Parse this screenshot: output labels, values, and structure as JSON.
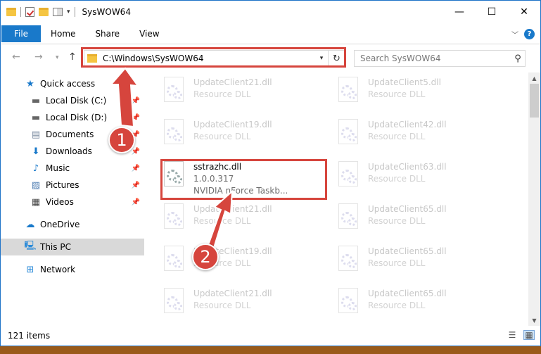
{
  "window": {
    "title": "SysWOW64",
    "controls": {
      "minimize": "—",
      "maximize": "☐",
      "close": "✕"
    }
  },
  "ribbon": {
    "tabs": [
      "File",
      "Home",
      "Share",
      "View"
    ],
    "help": "?"
  },
  "address": {
    "path": "C:\\Windows\\SysWOW64"
  },
  "search": {
    "placeholder": "Search SysWOW64"
  },
  "sidebar": {
    "items": [
      {
        "label": "Quick access",
        "icon": "star-icon",
        "pinned": false
      },
      {
        "label": "Local Disk (C:)",
        "icon": "drive-icon",
        "pinned": true
      },
      {
        "label": "Local Disk (D:)",
        "icon": "drive-icon",
        "pinned": true
      },
      {
        "label": "Documents",
        "icon": "documents-icon",
        "pinned": true
      },
      {
        "label": "Downloads",
        "icon": "download-icon",
        "pinned": true
      },
      {
        "label": "Music",
        "icon": "music-icon",
        "pinned": true
      },
      {
        "label": "Pictures",
        "icon": "pictures-icon",
        "pinned": true
      },
      {
        "label": "Videos",
        "icon": "videos-icon",
        "pinned": true
      },
      {
        "label": "OneDrive",
        "icon": "cloud-icon",
        "pinned": false
      },
      {
        "label": "This PC",
        "icon": "pc-icon",
        "pinned": false,
        "selected": true
      },
      {
        "label": "Network",
        "icon": "network-icon",
        "pinned": false
      }
    ]
  },
  "files": {
    "left": [
      {
        "name": "UpdateClient21.dll",
        "desc": "Resource DLL",
        "faded": true
      },
      {
        "name": "UpdateClient19.dll",
        "desc": "Resource DLL",
        "faded": true
      },
      {
        "name": "sstrazhc.dll",
        "version": "1.0.0.317",
        "desc": "NVIDIA nForce Taskb...",
        "faded": false
      },
      {
        "name": "UpdateClient21.dll",
        "desc": "Resource DLL",
        "faded": true
      },
      {
        "name": "UpdateClient19.dll",
        "desc": "Resource DLL",
        "faded": true
      },
      {
        "name": "UpdateClient21.dll",
        "desc": "Resource DLL",
        "faded": true
      }
    ],
    "right": [
      {
        "name": "UpdateClient5.dll",
        "desc": "Resource DLL",
        "faded": true
      },
      {
        "name": "UpdateClient42.dll",
        "desc": "Resource DLL",
        "faded": true
      },
      {
        "name": "UpdateClient63.dll",
        "desc": "Resource DLL",
        "faded": true
      },
      {
        "name": "UpdateClient65.dll",
        "desc": "Resource DLL",
        "faded": true
      },
      {
        "name": "UpdateClient65.dll",
        "desc": "Resource DLL",
        "faded": true
      },
      {
        "name": "UpdateClient65.dll",
        "desc": "Resource DLL",
        "faded": true
      }
    ]
  },
  "status": {
    "item_count": "121 items"
  },
  "callouts": [
    "1",
    "2"
  ],
  "colors": {
    "accent": "#1979ca",
    "highlight": "#d6453d",
    "selected": "#d9d9d9"
  }
}
